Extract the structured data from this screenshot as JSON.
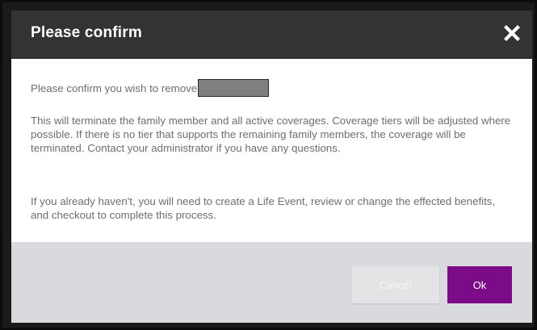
{
  "dialog": {
    "title": "Please confirm",
    "close_icon": "close-icon",
    "confirm_text": "Please confirm you wish to remove",
    "warning_text": "This will terminate the family member and all active coverages. Coverage tiers will be adjusted where possible. If there is no tier that supports the remaining family members, the coverage will be terminated. Contact your administrator if you have any questions.",
    "instruction_text": "If you already haven't, you will need to create a Life Event, review or change the effected benefits, and checkout to complete this process.",
    "cancel_label": "Cancel",
    "ok_label": "Ok"
  },
  "colors": {
    "header_bg": "#333333",
    "ok_bg": "#7b0b86",
    "footer_bg": "#d8dadd",
    "body_text": "#6e6e6e"
  }
}
